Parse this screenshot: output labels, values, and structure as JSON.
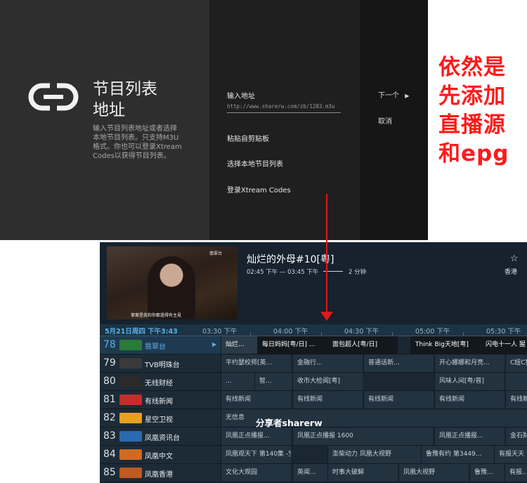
{
  "setup": {
    "title_line1": "节目列表",
    "title_line2": "地址",
    "description_lines": [
      "输入节目列表地址或者选择",
      "本地节目列表。只支持M3U",
      "格式。你也可以登录Xtream",
      "Codes以获得节目列表。"
    ],
    "url_label": "输入地址",
    "url_value": "http://www.sharerw.com/zb/1203.m3u",
    "paste_label": "粘贴自剪贴板",
    "local_label": "选择本地节目列表",
    "xtream_label": "登录Xtream Codes",
    "next_label": "下一个",
    "cancel_label": "取消"
  },
  "annotation": {
    "lines": [
      "依然是",
      "先添加",
      "直播源",
      "和epg"
    ],
    "color": "#ff1a1a"
  },
  "epg": {
    "preview_logo": "翡翠台",
    "preview_subtitle": "事實是我和你都過得有主見",
    "show_title": "灿烂的外母#10[粤]",
    "show_time": "02:45 下午 — 03:45 下午",
    "show_duration": "2 分钟",
    "region": "香港",
    "accent": "#5ab0e8",
    "date_label": "5月21日周四 下午3:43",
    "ticks": [
      "03:30 下午",
      "04:00 下午",
      "04:30 下午",
      "05:00 下午",
      "05:30 下午"
    ],
    "share_label": "分享者sharerw",
    "channels": [
      {
        "num": "78",
        "name": "翡翠台",
        "programs": [
          "灿烂...",
          "每日妈妈[粤/日] ...",
          "面包超人[粤/日]",
          "Think Big天地[粤]",
          "闪电十一人 猩"
        ]
      },
      {
        "num": "79",
        "name": "TVB明珠台",
        "programs": [
          "平约瑟校师[英...",
          "金融行...",
          "普通话新...",
          "开心娜娜和月亮...",
          "C妞C猫"
        ]
      },
      {
        "num": "80",
        "name": "无线财经",
        "programs": [
          "...",
          "智...",
          "收市大检阅[粤]",
          "风味人间[粤/普]",
          ""
        ]
      },
      {
        "num": "81",
        "name": "有线新闻",
        "programs": [
          "有线新闻",
          "有线新闻",
          "有线新闻",
          "有线新闻",
          "有线新"
        ]
      },
      {
        "num": "82",
        "name": "星空卫视",
        "programs": [
          "无信息"
        ]
      },
      {
        "num": "83",
        "name": "凤凰资讯台",
        "programs": [
          "凤凰正点播报...",
          "凤凰正点播报 1600",
          "凤凰正点播报...",
          "金石财"
        ]
      },
      {
        "num": "84",
        "name": "凤凰中文",
        "programs": [
          "凤凰观天下 第140集 -宝...",
          "澎柴动力 凤凰大视野",
          "鲁豫有约 第3449...",
          "有报天天"
        ]
      },
      {
        "num": "85",
        "name": "凤凰香港",
        "programs": [
          "文化大观园",
          "英闻...",
          "时事大破解",
          "凤凰大视野",
          "鲁豫...",
          "有报..."
        ]
      }
    ]
  }
}
